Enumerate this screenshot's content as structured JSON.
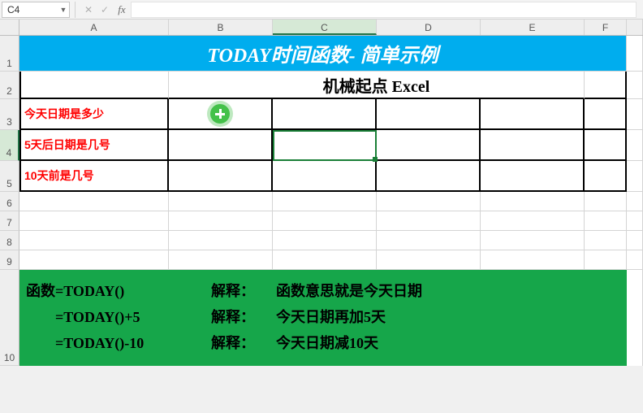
{
  "name_box": {
    "value": "C4"
  },
  "formula_bar": {
    "value": "",
    "fx_label": "fx"
  },
  "columns": [
    "A",
    "B",
    "C",
    "D",
    "E",
    "F"
  ],
  "rows": [
    "1",
    "2",
    "3",
    "4",
    "5",
    "6",
    "7",
    "8",
    "9",
    "10"
  ],
  "active_cell": "C4",
  "title": "TODAY时间函数- 简单示例",
  "subtitle": "机械起点 Excel",
  "questions": {
    "q1": "今天日期是多少",
    "q2": "5天后日期是几号",
    "q3": "10天前是几号"
  },
  "footer": {
    "lines": [
      {
        "formula": "函数=TODAY()",
        "label": "解释：",
        "desc": "函数意思就是今天日期"
      },
      {
        "formula": "　　=TODAY()+5",
        "label": "解释：",
        "desc": "今天日期再加5天"
      },
      {
        "formula": "　　=TODAY()-10",
        "label": "解释：",
        "desc": "今天日期减10天"
      }
    ]
  },
  "icons": {
    "plus": "plus-icon"
  }
}
